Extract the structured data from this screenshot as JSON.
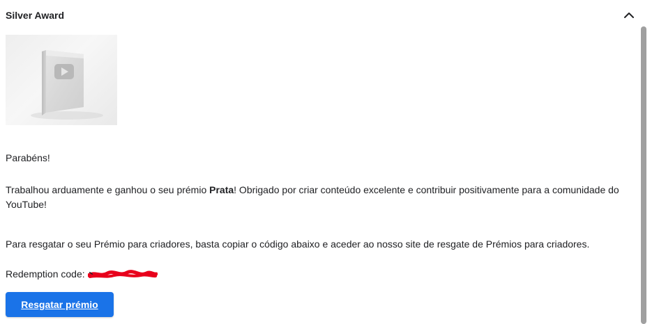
{
  "award": {
    "title": "Silver Award",
    "image_alt_icon": "play-button-plaque-icon"
  },
  "message": {
    "congrats": "Parabéns!",
    "body_before": "Trabalhou arduamente e ganhou o seu prémio ",
    "body_bold": "Prata",
    "body_after": "! Obrigado por criar conteúdo excelente e contribuir positivamente para a comunidade do YouTube!",
    "redeem_instructions": "Para resgatar o seu Prémio para criadores, basta copiar o código abaixo e aceder ao nosso site de resgate de Prémios para criadores.",
    "redemption_label": "Redemption code:"
  },
  "action": {
    "button_label": "Resgatar prémio"
  },
  "colors": {
    "accent": "#1a73e8",
    "redaction": "#e8001c"
  }
}
